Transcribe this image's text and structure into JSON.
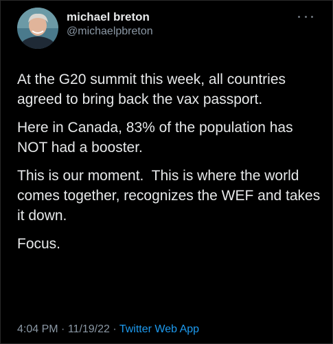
{
  "tweet": {
    "display_name": "michael breton",
    "handle": "@michaelpbreton",
    "paragraphs": [
      "At the G20 summit this week, all countries agreed to bring back the vax passport.",
      "Here in Canada, 83% of the population has NOT had a booster.",
      "This is our moment.  This is where the world comes together, recognizes the WEF and takes it down.",
      "Focus."
    ],
    "time": "4:04 PM",
    "date": "11/19/22",
    "separator": "·",
    "source_app": "Twitter Web App"
  },
  "colors": {
    "background": "#000000",
    "text": "#e7e9ea",
    "secondary": "#8b98a5",
    "link": "#1d9bf0"
  },
  "icons": {
    "more": "more-horizontal-icon",
    "avatar": "user-avatar"
  }
}
